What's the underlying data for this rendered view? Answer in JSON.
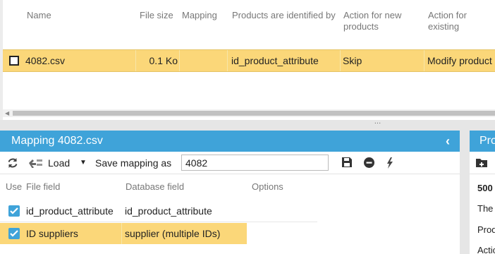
{
  "top_grid": {
    "columns": [
      "Name",
      "File size",
      "Mapping",
      "Products are identified by",
      "Action for new products",
      "Action for existing products"
    ],
    "row": {
      "name": "4082.csv",
      "file_size": "0.1 Ko",
      "mapping": "",
      "identified_by": "id_product_attribute",
      "action_new": "Skip",
      "action_existing": "Modify product"
    }
  },
  "mapping_panel": {
    "title": "Mapping 4082.csv",
    "collapse_glyph": "‹",
    "toolbar": {
      "load_label": "Load",
      "save_mapping_label": "Save mapping as",
      "mapping_name_value": "4082"
    },
    "columns": {
      "use": "Use",
      "file_field": "File field",
      "database_field": "Database field",
      "options": "Options"
    },
    "rows": [
      {
        "checked": true,
        "file_field": "id_product_attribute",
        "database_field": "id_product_attribute",
        "options": ""
      },
      {
        "checked": true,
        "file_field": "ID suppliers",
        "database_field": "supplier (multiple IDs)",
        "options": ""
      }
    ]
  },
  "right_panel": {
    "title": "Pro",
    "lines": [
      "500",
      "The",
      "Prod",
      "Actio"
    ]
  },
  "icons": {
    "refresh": "refresh-icon",
    "load": "load-icon",
    "dropdown": "chevron-down-icon",
    "save": "floppy-icon",
    "delete": "minus-circle-icon",
    "flash": "lightning-icon",
    "add_folder": "add-folder-icon"
  },
  "colors": {
    "accent": "#3fa3d9",
    "selected_row": "#fbd779"
  }
}
